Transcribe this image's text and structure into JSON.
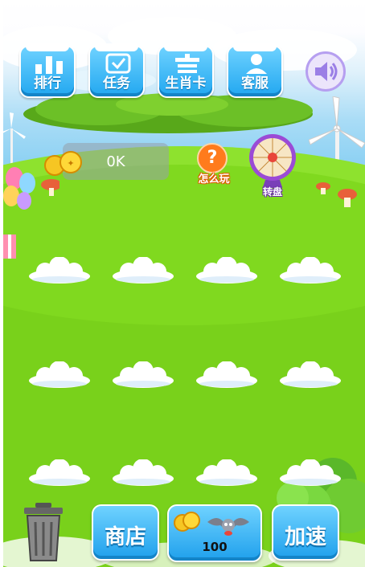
{
  "top_buttons": [
    {
      "label": "排行",
      "icon": "bar-chart-icon"
    },
    {
      "label": "任务",
      "icon": "checkbox-icon"
    },
    {
      "label": "生肖卡",
      "icon": "card-box-icon"
    },
    {
      "label": "客服",
      "icon": "person-icon"
    }
  ],
  "coin_display": {
    "value": "0K"
  },
  "how_to_play": {
    "label": "怎么玩"
  },
  "wheel": {
    "label": "转盘"
  },
  "cloud_slots": {
    "rows": 3,
    "columns": 4
  },
  "bottom": {
    "shop_label": "商店",
    "speed_label": "加速",
    "buy_price": "100"
  },
  "colors": {
    "grass": "#7ad11c",
    "button": "#21a7f0",
    "sky": "#a9dcf6"
  }
}
